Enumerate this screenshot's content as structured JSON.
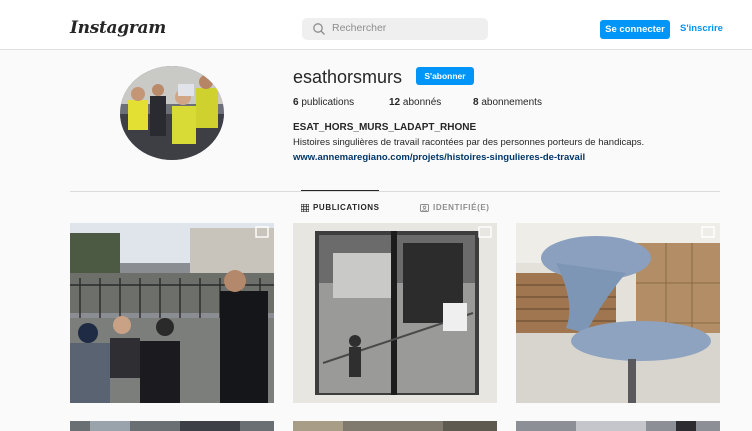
{
  "header": {
    "logo": "Instagram",
    "search_placeholder": "Rechercher",
    "login_label": "Se connecter",
    "signup_label": "S'inscrire"
  },
  "profile": {
    "username": "esathorsmurs",
    "follow_label": "S'abonner",
    "posts_count": "6",
    "posts_label": "publications",
    "followers_count": "12",
    "followers_label": "abonnés",
    "following_count": "8",
    "following_label": "abonnements",
    "full_name": "ESAT_HORS_MURS_LADAPT_RHONE",
    "bio": "Histoires singulières de travail racontées par des personnes porteurs de handicaps.",
    "website": "www.annemaregiano.com/projets/histoires-singulieres-de-travail"
  },
  "tabs": [
    {
      "label": "PUBLICATIONS",
      "active": true,
      "icon": "grid-icon"
    },
    {
      "label": "IDENTIFIÉ(E)",
      "active": false,
      "icon": "tag-icon"
    }
  ],
  "colors": {
    "accent": "#0095f6",
    "link": "#00376b",
    "background": "#fafafa"
  }
}
